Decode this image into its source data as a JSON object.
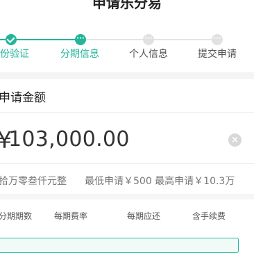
{
  "header": {
    "title": "申请乐分易"
  },
  "steps": [
    {
      "label": "身份验证",
      "state": "done"
    },
    {
      "label": "分期信息",
      "state": "active"
    },
    {
      "label": "个人信息",
      "state": "todo"
    },
    {
      "label": "提交申请",
      "state": "todo"
    }
  ],
  "amount": {
    "title": "申请金额",
    "currency": "¥",
    "value": "103,000.00",
    "uppercase": "拾万零叁仟元整",
    "limits": "最低申请￥500 最高申请￥10.3万"
  },
  "installment_table": {
    "columns": [
      "分期期数",
      "每期费率",
      "每期应还",
      "含手续费"
    ]
  },
  "colors": {
    "accent": "#23b59b",
    "inactive": "#e1e1e1"
  }
}
